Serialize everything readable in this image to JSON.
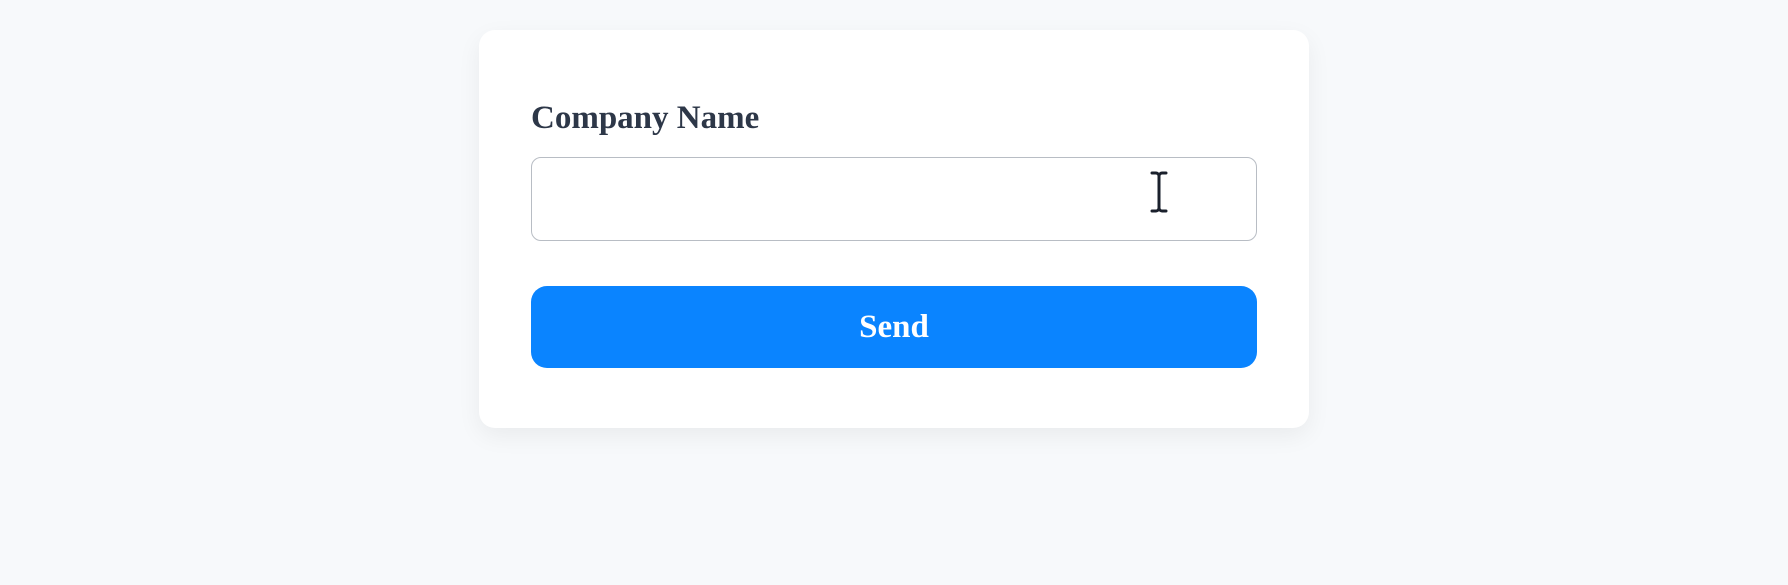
{
  "form": {
    "label": "Company Name",
    "input_value": "",
    "input_placeholder": "",
    "button_label": "Send"
  }
}
